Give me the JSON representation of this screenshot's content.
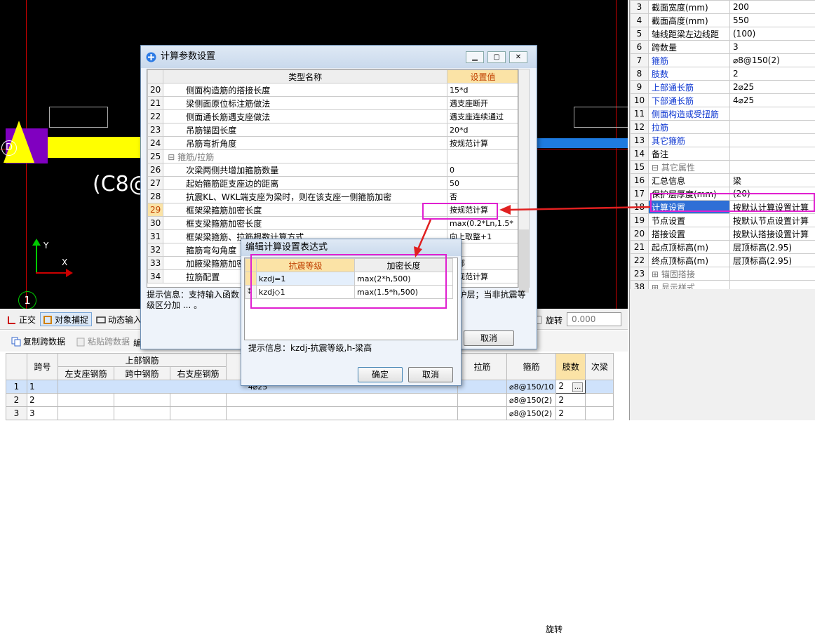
{
  "canvas": {
    "beam_text": "(C8@",
    "grid_circle_1": "D",
    "grid_circle_2": "1",
    "axis_x": "X",
    "axis_y": "Y"
  },
  "toolbar": {
    "ortho": "正交",
    "snap": "对象捕捉",
    "dynamic": "动态输入",
    "rotate_label": "旋转",
    "rotate_value": "0.000",
    "copy_span": "复制跨数据",
    "paste_span": "粘贴跨数据",
    "extra": "编"
  },
  "bottom_grid": {
    "headers": {
      "span_no": "跨号",
      "top_rebar": "上部钢筋",
      "left_seat": "左支座钢筋",
      "mid_span": "跨中钢筋",
      "right_seat": "右支座钢筋",
      "tie": "拉筋",
      "stirrup": "箍筋",
      "legs": "肢数",
      "next": "次梁"
    },
    "rows": [
      {
        "idx": "1",
        "span": "1",
        "top": "4⌀25",
        "stirrup": "⌀8@150/10",
        "legs": "2"
      },
      {
        "idx": "2",
        "span": "2",
        "top": "",
        "stirrup": "⌀8@150(2)",
        "legs": "2"
      },
      {
        "idx": "3",
        "span": "3",
        "top": "",
        "stirrup": "⌀8@150(2)",
        "legs": "2"
      }
    ],
    "more_btn": "..."
  },
  "right_panel": {
    "rows": [
      {
        "num": "3",
        "name": "截面宽度(mm)",
        "value": "200",
        "style": ""
      },
      {
        "num": "4",
        "name": "截面高度(mm)",
        "value": "550",
        "style": ""
      },
      {
        "num": "5",
        "name": "轴线距梁左边线距",
        "value": "(100)",
        "style": ""
      },
      {
        "num": "6",
        "name": "跨数量",
        "value": "3",
        "style": ""
      },
      {
        "num": "7",
        "name": "箍筋",
        "value": "⌀8@150(2)",
        "style": "blue"
      },
      {
        "num": "8",
        "name": "肢数",
        "value": "2",
        "style": "blue"
      },
      {
        "num": "9",
        "name": "上部通长筋",
        "value": "2⌀25",
        "style": "blue"
      },
      {
        "num": "10",
        "name": "下部通长筋",
        "value": "4⌀25",
        "style": "blue"
      },
      {
        "num": "11",
        "name": "侧面构造或受扭筋",
        "value": "",
        "style": "blue"
      },
      {
        "num": "12",
        "name": "拉筋",
        "value": "",
        "style": "blue"
      },
      {
        "num": "13",
        "name": "其它箍筋",
        "value": "",
        "style": "blue"
      },
      {
        "num": "14",
        "name": "备注",
        "value": "",
        "style": ""
      },
      {
        "num": "15",
        "name": "⊟ 其它属性",
        "value": "",
        "style": "gray"
      },
      {
        "num": "16",
        "name": "  汇总信息",
        "value": "梁",
        "style": ""
      },
      {
        "num": "17",
        "name": "  保护层厚度(mm)",
        "value": "(20)",
        "style": ""
      },
      {
        "num": "18",
        "name": "  计算设置",
        "value": "按默认计算设置计算",
        "style": "sel"
      },
      {
        "num": "19",
        "name": "  节点设置",
        "value": "按默认节点设置计算",
        "style": ""
      },
      {
        "num": "20",
        "name": "  搭接设置",
        "value": "按默认搭接设置计算",
        "style": ""
      },
      {
        "num": "21",
        "name": "  起点顶标高(m)",
        "value": "层顶标高(2.95)",
        "style": ""
      },
      {
        "num": "22",
        "name": "  终点顶标高(m)",
        "value": "层顶标高(2.95)",
        "style": ""
      },
      {
        "num": "23",
        "name": "⊞ 锚固搭接",
        "value": "",
        "style": "gray"
      },
      {
        "num": "38",
        "name": "⊞ 显示样式",
        "value": "",
        "style": "gray"
      }
    ]
  },
  "dialog1": {
    "title": "计算参数设置",
    "col_name": "类型名称",
    "col_value": "设置值",
    "rows": [
      {
        "n": "20",
        "name": "侧面构造筋的搭接长度",
        "value": "15*d"
      },
      {
        "n": "21",
        "name": "梁侧面原位标注筋做法",
        "value": "遇支座断开"
      },
      {
        "n": "22",
        "name": "侧面通长筋遇支座做法",
        "value": "遇支座连续通过"
      },
      {
        "n": "23",
        "name": "吊筋锚固长度",
        "value": "20*d"
      },
      {
        "n": "24",
        "name": "吊筋弯折角度",
        "value": "按规范计算"
      },
      {
        "n": "25",
        "name": "⊟ 箍筋/拉筋",
        "value": ""
      },
      {
        "n": "26",
        "name": "次梁两侧共增加箍筋数量",
        "value": "0"
      },
      {
        "n": "27",
        "name": "起始箍筋距支座边的距离",
        "value": "50"
      },
      {
        "n": "28",
        "name": "抗震KL、WKL端支座为梁时，则在该支座一侧箍筋加密",
        "value": "否"
      },
      {
        "n": "29",
        "name": "框架梁箍筋加密长度",
        "value": "按规范计算"
      },
      {
        "n": "30",
        "name": "框支梁箍筋加密长度",
        "value": "max(0.2*Ln,1.5*"
      },
      {
        "n": "31",
        "name": "框架梁箍筋、拉筋根数计算方式",
        "value": "向上取整+1"
      },
      {
        "n": "32",
        "name": "箍筋弯勾角度",
        "value": ""
      },
      {
        "n": "33",
        "name": "加腋梁箍筋加密",
        "value": "端部"
      },
      {
        "n": "34",
        "name": "拉筋配置",
        "value": "按规范计算"
      }
    ],
    "tip": "提示信息：支持输入函数 ... ab:基本锚固长度；la:锚固长度；ll:搭 ... 跨长；bhc:保护层；当非抗震等级区分加 ... 。",
    "cancel": "取消"
  },
  "dialog2": {
    "title": "编辑计算设置表达式",
    "col_level": "抗震等级",
    "col_length": "加密长度",
    "rows": [
      {
        "level": "kzdj=1",
        "length": "max(2*h,500)"
      },
      {
        "level": "kzdj◇1",
        "length": "max(1.5*h,500)"
      }
    ],
    "tip": "提示信息：kzdj-抗震等级,h-梁高",
    "ok": "确定",
    "cancel": "取消"
  },
  "colors": {
    "highlight": "#e020d0",
    "arrow": "#e02020",
    "header_yellow": "#fbe3a6",
    "link_blue": "#0b35d0"
  }
}
